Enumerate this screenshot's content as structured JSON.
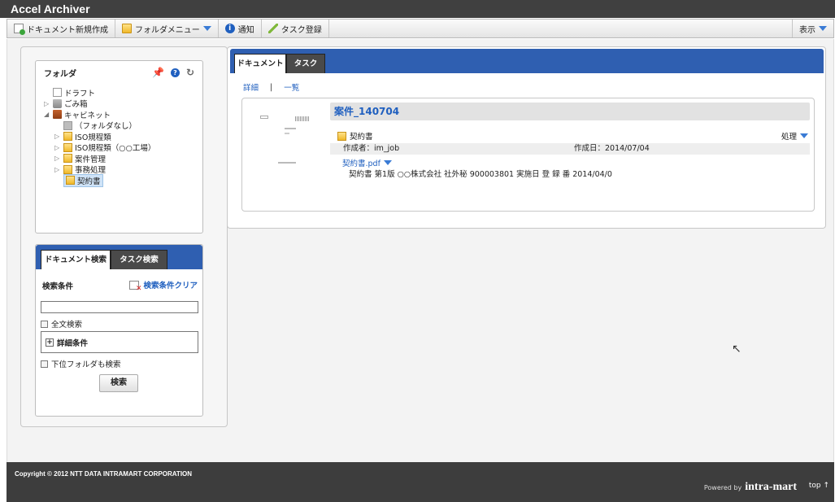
{
  "app": {
    "title": "Accel Archiver"
  },
  "toolbar": {
    "new_document": "ドキュメント新規作成",
    "folder_menu": "フォルダメニュー",
    "notify": "通知",
    "task_register": "タスク登録",
    "view": "表示"
  },
  "folder_panel": {
    "title": "フォルダ",
    "tree": [
      {
        "label": "ドラフト"
      },
      {
        "label": "ごみ箱"
      },
      {
        "label": "キャビネット"
      },
      {
        "label": "（フォルダなし）"
      },
      {
        "label": "ISO規程類"
      },
      {
        "label": "ISO規程類（○○工場）"
      },
      {
        "label": "案件管理"
      },
      {
        "label": "事務処理"
      },
      {
        "label": "契約書"
      }
    ]
  },
  "search_panel": {
    "tabs": [
      "ドキュメント検索",
      "タスク検索"
    ],
    "condition_label": "検索条件",
    "clear_label": "検索条件クリア",
    "input_value": "",
    "fulltext_label": "全文検索",
    "detail_label": "詳細条件",
    "subfolder_label": "下位フォルダも検索",
    "search_button": "検索"
  },
  "content": {
    "tabs": [
      "ドキュメント",
      "タスク"
    ],
    "view_links": [
      "詳細",
      "一覧"
    ],
    "document": {
      "title": "案件_140704",
      "folder": "契約書",
      "action": "処理",
      "author": "作成者：im_job",
      "created": "作成日：2014/07/04",
      "file": "契約書.pdf",
      "description": "契約書 第1版 ○○株式会社 社外秘 900003801 実施日 登 録 番 2014/04/0"
    }
  },
  "footer": {
    "copyright": "Copyright © 2012 NTT DATA INTRAMART CORPORATION",
    "powered_by": "Powered by",
    "brand": "intra-mart",
    "top": "top ↑"
  },
  "colors": {
    "accent": "#2f5fb1",
    "titlebar": "#404040",
    "footer": "#3d3d3d",
    "link": "#1f5fbf"
  }
}
